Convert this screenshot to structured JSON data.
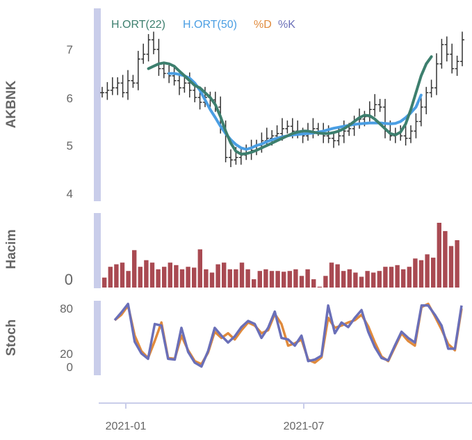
{
  "colors": {
    "ma22": "#3d7f6e",
    "ma50": "#4a9ee3",
    "pctD": "#e08a3c",
    "pctK": "#6a6fb8",
    "ohlc": "#333333",
    "volume": "#a94a52",
    "panel_strip": "#c9cdea",
    "grid": "#e6e6e6"
  },
  "chart_data": [
    {
      "type": "line",
      "panel": "price",
      "ylabel": "AKBNK",
      "yticks": [
        "4",
        "5",
        "6",
        "7"
      ],
      "ylim": [
        3.9,
        7.85
      ],
      "legend": [
        "H.ORT(22)",
        "H.ORT(50)",
        "%D",
        "%K"
      ],
      "legend_placement": "top-left",
      "ohlc_close_approx": [
        6.1,
        6.15,
        6.2,
        6.3,
        6.1,
        6.35,
        6.3,
        6.8,
        6.9,
        7.2,
        7.0,
        6.6,
        6.5,
        6.45,
        6.35,
        6.2,
        6.3,
        6.15,
        6.0,
        5.9,
        6.0,
        5.95,
        5.8,
        5.4,
        4.75,
        4.7,
        4.75,
        4.8,
        4.85,
        4.9,
        5.0,
        5.1,
        5.15,
        5.2,
        5.25,
        5.35,
        5.4,
        5.3,
        5.25,
        5.2,
        5.3,
        5.35,
        5.3,
        5.2,
        5.15,
        5.1,
        5.2,
        5.3,
        5.35,
        5.45,
        5.55,
        5.6,
        5.75,
        5.85,
        5.8,
        5.3,
        5.2,
        5.25,
        5.2,
        5.15,
        5.3,
        5.5,
        5.8,
        6.1,
        6.2,
        6.7,
        7.1,
        6.9,
        6.6,
        6.75,
        7.2
      ],
      "series": [
        {
          "name": "H.ORT(22)",
          "x_start": 9,
          "values": [
            6.6,
            6.65,
            6.7,
            6.72,
            6.7,
            6.65,
            6.55,
            6.45,
            6.35,
            6.25,
            6.2,
            6.1,
            6.0,
            5.85,
            5.6,
            5.3,
            5.05,
            4.88,
            4.82,
            4.83,
            4.86,
            4.9,
            4.95,
            5.0,
            5.05,
            5.1,
            5.15,
            5.2,
            5.25,
            5.28,
            5.3,
            5.3,
            5.28,
            5.26,
            5.25,
            5.25,
            5.27,
            5.3,
            5.35,
            5.42,
            5.5,
            5.58,
            5.63,
            5.62,
            5.55,
            5.45,
            5.35,
            5.25,
            5.22,
            5.28,
            5.45,
            5.75,
            6.1,
            6.45,
            6.7,
            6.85
          ]
        },
        {
          "name": "H.ORT(50)",
          "x_start": 13,
          "values": [
            6.5,
            6.5,
            6.48,
            6.45,
            6.4,
            6.3,
            6.15,
            5.95,
            5.75,
            5.58,
            5.4,
            5.25,
            5.12,
            5.02,
            4.95,
            4.92,
            4.95,
            5.0,
            5.03,
            5.08,
            5.12,
            5.15,
            5.18,
            5.2,
            5.22,
            5.23,
            5.24,
            5.25,
            5.26,
            5.28,
            5.3,
            5.33,
            5.36,
            5.38,
            5.4,
            5.42,
            5.44,
            5.45,
            5.46,
            5.47,
            5.47,
            5.47,
            5.46,
            5.45,
            5.46,
            5.5,
            5.58,
            5.68,
            5.8,
            6.05
          ]
        }
      ]
    },
    {
      "type": "bar",
      "panel": "volume",
      "ylabel": "Hacim",
      "yticks": [
        "0"
      ],
      "values_relative": [
        12,
        25,
        28,
        30,
        20,
        45,
        25,
        33,
        30,
        22,
        25,
        30,
        27,
        22,
        25,
        24,
        46,
        22,
        18,
        28,
        30,
        22,
        22,
        30,
        22,
        10,
        20,
        22,
        20,
        20,
        19,
        20,
        22,
        14,
        22,
        10,
        1,
        14,
        30,
        28,
        20,
        22,
        18,
        13,
        20,
        18,
        20,
        25,
        25,
        27,
        22,
        25,
        35,
        33,
        40,
        36,
        78,
        68,
        50,
        57
      ]
    },
    {
      "type": "line",
      "panel": "stochastic",
      "ylabel": "Stoch",
      "yticks": [
        "0",
        "20",
        "80"
      ],
      "ylim": [
        0,
        100
      ],
      "x": [
        "2021-01",
        "2021-07"
      ],
      "series": [
        {
          "name": "%D",
          "values": [
            65,
            72,
            84,
            45,
            25,
            16,
            38,
            62,
            16,
            15,
            45,
            26,
            12,
            8,
            23,
            50,
            42,
            48,
            40,
            52,
            62,
            58,
            48,
            52,
            73,
            60,
            32,
            35,
            40,
            14,
            10,
            17,
            68,
            55,
            58,
            62,
            65,
            72,
            57,
            36,
            18,
            12,
            30,
            48,
            38,
            32,
            82,
            86,
            70,
            53,
            34,
            26,
            80
          ]
        },
        {
          "name": "%K",
          "values": [
            65,
            75,
            86,
            37,
            22,
            15,
            60,
            58,
            15,
            14,
            55,
            24,
            10,
            5,
            25,
            55,
            45,
            36,
            44,
            56,
            64,
            60,
            42,
            55,
            76,
            42,
            40,
            32,
            45,
            12,
            14,
            19,
            84,
            48,
            62,
            56,
            68,
            78,
            50,
            30,
            16,
            13,
            32,
            50,
            42,
            36,
            84,
            84,
            72,
            58,
            28,
            28,
            84
          ]
        }
      ]
    },
    {
      "type": "axis",
      "panel": "time",
      "x_tick_labels": [
        "2021-01",
        "2021-07"
      ]
    }
  ]
}
